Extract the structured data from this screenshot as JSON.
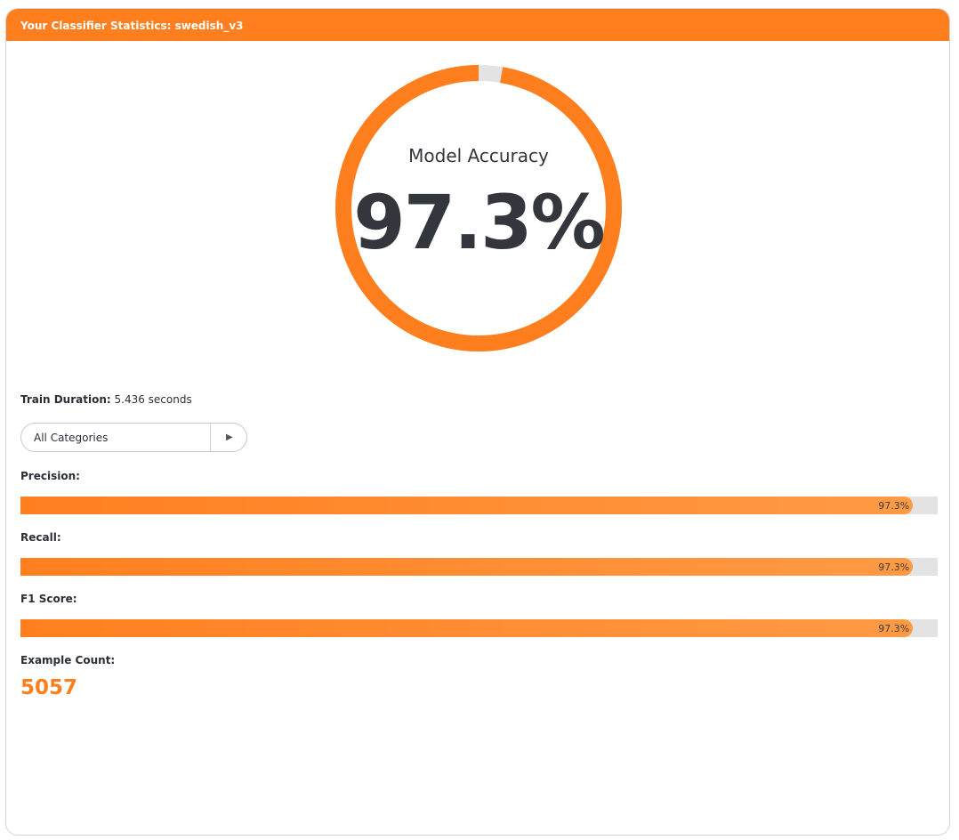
{
  "header": {
    "title": "Your Classifier Statistics: swedish_v3"
  },
  "accuracy": {
    "label": "Model Accuracy",
    "value_text": "97.3%",
    "value": 0.973,
    "color": "#ff7f1f",
    "track_color": "#e3e3e3"
  },
  "train": {
    "label": "Train Duration:",
    "value": "5.436 seconds"
  },
  "category_select": {
    "selected": "All Categories",
    "arrow_icon": "caret-right-icon"
  },
  "metrics": [
    {
      "label": "Precision:",
      "value_text": "97.3%",
      "value": 0.973
    },
    {
      "label": "Recall:",
      "value_text": "97.3%",
      "value": 0.973
    },
    {
      "label": "F1 Score:",
      "value_text": "97.3%",
      "value": 0.973
    }
  ],
  "example_count": {
    "label": "Example Count:",
    "value": "5057"
  }
}
